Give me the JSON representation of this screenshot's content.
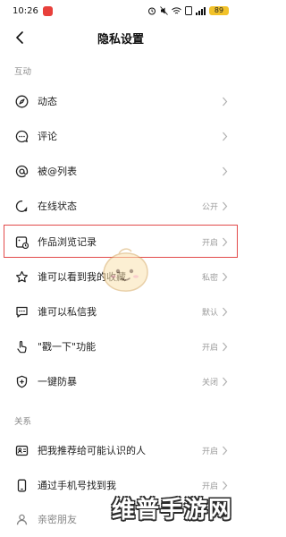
{
  "status_bar": {
    "time": "10:26",
    "battery": "89"
  },
  "nav": {
    "title": "隐私设置"
  },
  "sections": {
    "interaction": "互动",
    "relations": "关系"
  },
  "rows": {
    "dynamics": {
      "label": "动态",
      "value": "",
      "icon": "compass-icon"
    },
    "comments": {
      "label": "评论",
      "value": "",
      "icon": "comment-icon"
    },
    "mentions": {
      "label": "被@列表",
      "value": "",
      "icon": "at-icon"
    },
    "online_status": {
      "label": "在线状态",
      "value": "公开",
      "icon": "online-status-icon"
    },
    "view_history": {
      "label": "作品浏览记录",
      "value": "开启",
      "icon": "view-history-icon"
    },
    "favorites": {
      "label": "谁可以看到我的收藏",
      "value": "私密",
      "icon": "star-icon"
    },
    "private_message": {
      "label": "谁可以私信我",
      "value": "默认",
      "icon": "message-icon"
    },
    "poke": {
      "label": "\"戳一下\"功能",
      "value": "开启",
      "icon": "poke-hand-icon"
    },
    "anti_harass": {
      "label": "一键防暴",
      "value": "关闭",
      "icon": "shield-plus-icon"
    },
    "recommend": {
      "label": "把我推荐给可能认识的人",
      "value": "开启",
      "icon": "contact-card-icon"
    },
    "phone_find": {
      "label": "通过手机号找到我",
      "value": "开启",
      "icon": "phone-icon"
    },
    "close_friends": {
      "label": "亲密朋友",
      "value": "",
      "icon": "person-icon"
    }
  },
  "watermark": "维普手游网",
  "colors": {
    "highlight_border": "#e24a4a",
    "battery": "#f2c229",
    "secondary_text": "#9a9a9a"
  }
}
